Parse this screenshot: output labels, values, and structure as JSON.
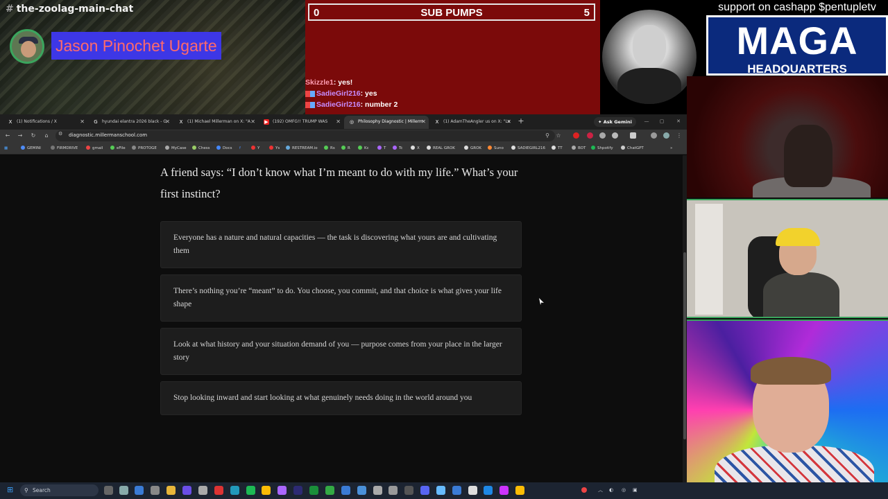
{
  "overlay": {
    "channel_hash": "#",
    "channel_name": "the-zoolag-main-chat",
    "speaker_name": "Jason Pinochet Ugarte",
    "scoreboard": {
      "left_score": "0",
      "title": "SUB PUMPS",
      "right_score": "5"
    },
    "chat": [
      {
        "user": "Skizzle1",
        "message": " yes!",
        "badged": false
      },
      {
        "user": "SadieGirl216",
        "message": " yes",
        "badged": true
      },
      {
        "user": "SadieGirl216",
        "message": " number 2",
        "badged": true
      }
    ],
    "support_text": "support on cashapp $pentupletv",
    "logo_title": "MAGA",
    "logo_sub": "HEADQUARTERS"
  },
  "browser": {
    "tabs": [
      {
        "label": "(1) Notifications / X",
        "favicon": "X",
        "active": false
      },
      {
        "label": "hyundai elantra 2026 black - G",
        "favicon": "G",
        "active": false
      },
      {
        "label": "(1) Michael Millerman on X: \"A",
        "favicon": "X",
        "active": false
      },
      {
        "label": "(192) OMFG!! TRUMP WAS",
        "favicon": "▶",
        "active": false
      },
      {
        "label": "Philosophy Diagnostic | Millerm",
        "favicon": "◎",
        "active": true
      },
      {
        "label": "(1) AdamTheAngler us on X: \"Lo",
        "favicon": "X",
        "active": false
      }
    ],
    "new_tab": "+",
    "ask_gemini": "✦ Ask Gemini",
    "window_buttons": [
      "—",
      "▢",
      "✕"
    ],
    "url": "diagnostic.millermanschool.com",
    "bookmarks": [
      "GEMINI",
      "FIRMDRIVE",
      "gmail",
      "eFile",
      "PROTOGE",
      "MyCase",
      "Chess",
      "Docs",
      "f",
      "Y",
      "Ys",
      "RESTREAM.io",
      "Rs",
      "R",
      "Kc",
      "T",
      "Tc",
      "X",
      "REAL GROK",
      "GROK",
      "Suno",
      "SADIEGIRL216",
      "TT",
      "BOT",
      "Shpotify",
      "ChatGPT"
    ]
  },
  "page": {
    "question": "A friend says: “I don’t know what I’m meant to do with my life.” What’s your first instinct?",
    "options": [
      "Everyone has a nature and natural capacities — the task is discovering what yours are and cultivating them",
      "There’s nothing you’re “meant” to do. You choose, you commit, and that choice is what gives your life shape",
      "Look at what history and your situation demand of you — purpose comes from your place in the larger story",
      "Stop looking inward and start looking at what genuinely needs doing in the world around you"
    ]
  },
  "taskbar": {
    "search_label": "Search"
  },
  "colors": {
    "scoreboard_bg": "#7b0a0a",
    "speaker_tag_bg": "#3d37e6",
    "speaker_tag_text": "#ff6a6a",
    "logo_bg": "#0b2a7d",
    "speaking_ring": "#3ba55d",
    "page_bg": "#0d0d0d",
    "option_bg": "#1d1d1d"
  }
}
